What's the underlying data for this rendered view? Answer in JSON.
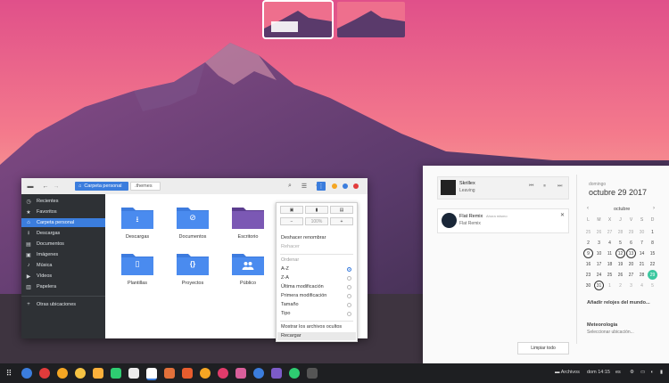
{
  "file_manager": {
    "path": [
      "Carpeta personal",
      ".themes"
    ],
    "sidebar": [
      {
        "label": "Recientes",
        "icon": "clock-icon"
      },
      {
        "label": "Favoritos",
        "icon": "star-icon"
      },
      {
        "label": "Carpeta personal",
        "icon": "home-icon"
      },
      {
        "label": "Descargas",
        "icon": "download-icon"
      },
      {
        "label": "Documentos",
        "icon": "document-icon"
      },
      {
        "label": "Imágenes",
        "icon": "image-icon"
      },
      {
        "label": "Música",
        "icon": "music-icon"
      },
      {
        "label": "Vídeos",
        "icon": "video-icon"
      },
      {
        "label": "Papelera",
        "icon": "trash-icon"
      },
      {
        "label": "Otras ubicaciones",
        "icon": "plus-icon"
      }
    ],
    "folders": [
      {
        "label": "Descargas",
        "glyph": "⭳"
      },
      {
        "label": "Documentos",
        "glyph": "⊘"
      },
      {
        "label": "Escritorio",
        "glyph": ""
      },
      {
        "label": "Plantillas",
        "glyph": "▯"
      },
      {
        "label": "Proyectos",
        "glyph": "{}"
      },
      {
        "label": "Público",
        "glyph": "👥"
      }
    ]
  },
  "menu": {
    "zoom": "100%",
    "undo": "Deshacer renombrar",
    "redo": "Rehacer",
    "sort_header": "Ordenar",
    "sort_options": [
      "A-Z",
      "Z-A",
      "Última modificación",
      "Primera modificación",
      "Tamaño",
      "Tipo"
    ],
    "show_hidden": "Mostrar los archivos ocultos",
    "reload": "Recargar"
  },
  "notifications": {
    "media": {
      "title": "Skrillex",
      "subtitle": "Leaving"
    },
    "notice": {
      "title": "Flat Remix",
      "meta": "Ahora mismo",
      "subtitle": "Flat Remix"
    },
    "clear": "Limpiar todo"
  },
  "calendar": {
    "weekday": "domingo",
    "date": "octubre 29 2017",
    "month": "octubre",
    "dow": [
      "L",
      "M",
      "X",
      "J",
      "V",
      "S",
      "D"
    ],
    "weeks": [
      [
        "25",
        "26",
        "27",
        "28",
        "29",
        "30",
        "1"
      ],
      [
        "2",
        "3",
        "4",
        "5",
        "6",
        "7",
        "8"
      ],
      [
        "9",
        "10",
        "11",
        "12",
        "13",
        "14",
        "15"
      ],
      [
        "16",
        "17",
        "18",
        "19",
        "20",
        "21",
        "22"
      ],
      [
        "23",
        "24",
        "25",
        "26",
        "27",
        "28",
        "29"
      ],
      [
        "30",
        "31",
        "1",
        "2",
        "3",
        "4",
        "5"
      ]
    ],
    "add_clocks": "Añadir relojes del mundo...",
    "weather_title": "Meteorología",
    "weather_sub": "Seleccionar ubicación..."
  },
  "taskbar": {
    "archivos": "Archivos",
    "clock": "dom 14:15",
    "lang": "es"
  },
  "colors": {
    "accent": "#3b7ddd",
    "folder": "#3d7bde",
    "today": "#3cc8a0"
  }
}
